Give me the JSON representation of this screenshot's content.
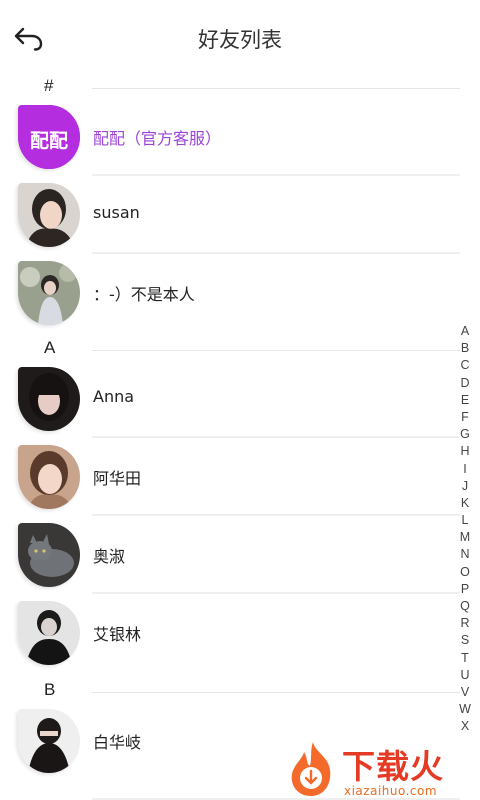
{
  "header": {
    "title": "好友列表"
  },
  "sections": [
    {
      "letter": "#",
      "contacts": [
        {
          "name": "配配（官方客服）",
          "avatar_text": "配配",
          "official": true
        },
        {
          "name": "susan"
        },
        {
          "name": "：-）不是本人"
        }
      ]
    },
    {
      "letter": "A",
      "contacts": [
        {
          "name": "Anna"
        },
        {
          "name": "阿华田"
        },
        {
          "name": "奥淑"
        },
        {
          "name": "艾银林"
        }
      ]
    },
    {
      "letter": "B",
      "contacts": [
        {
          "name": "白华岐"
        }
      ]
    }
  ],
  "index_letters": [
    "A",
    "B",
    "C",
    "D",
    "E",
    "F",
    "G",
    "H",
    "I",
    "J",
    "K",
    "L",
    "M",
    "N",
    "O",
    "P",
    "Q",
    "R",
    "S",
    "T",
    "U",
    "V",
    "W",
    "X"
  ],
  "watermark": {
    "text": "下载火",
    "url": "xiazaihuo.com"
  },
  "colors": {
    "accent": "#9a45d6",
    "watermark": "#e53b25"
  }
}
